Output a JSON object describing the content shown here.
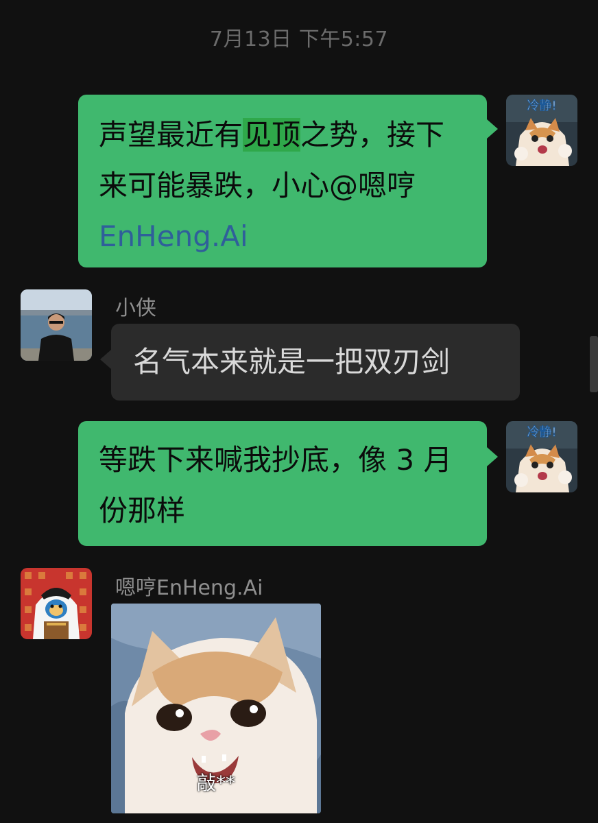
{
  "chat": {
    "timestamp": "7月13日 下午5:57",
    "messages": [
      {
        "direction": "outgoing",
        "parts": [
          "声望最近有",
          "见顶",
          "之势，接下来可能暴跌，小心@嗯哼",
          "EnHeng.Ai"
        ]
      },
      {
        "direction": "incoming",
        "sender": "小侠",
        "text": "名气本来就是一把双刃剑"
      },
      {
        "direction": "outgoing",
        "text": "等跌下来喊我抄底，像 3 月份那样"
      },
      {
        "direction": "incoming",
        "sender": "嗯哼EnHeng.Ai",
        "image_caption": "敲**"
      }
    ],
    "avatar_stickers": {
      "self_sticker_text": "冷静!"
    }
  },
  "colors": {
    "background": "#111111",
    "outgoing_bubble": "#40b86e",
    "incoming_bubble": "#2b2b2b",
    "mention": "#2f5f9a",
    "highlight": "#2fa84a"
  }
}
